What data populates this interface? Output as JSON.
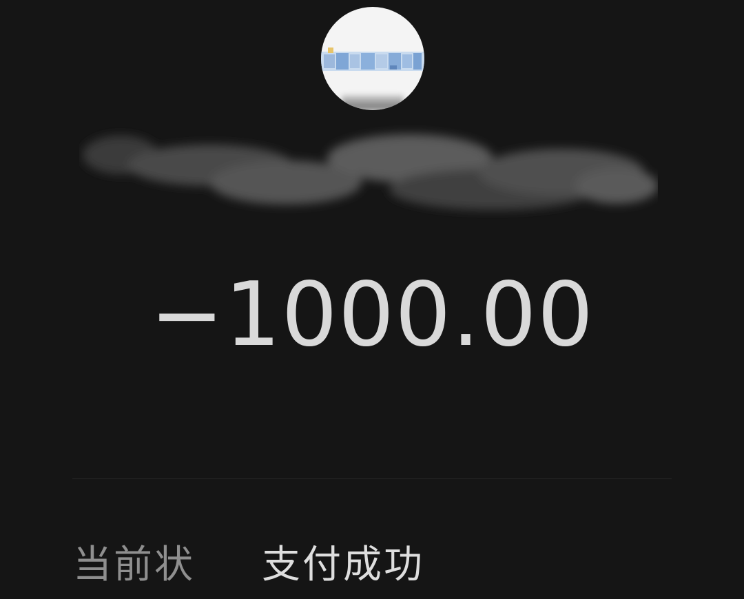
{
  "transaction": {
    "amount": "−1000.00",
    "status_label": "当前状",
    "status_value": "支付成功"
  },
  "colors": {
    "background": "#151515",
    "amount_text": "#d9d9d9",
    "label_text": "#8f8f8f",
    "value_text": "#dedede",
    "avatar_bg": "#f4f4f4",
    "logo_blue": "#8fb4e0"
  },
  "icons": {
    "merchant_avatar": "merchant-logo-avatar"
  }
}
